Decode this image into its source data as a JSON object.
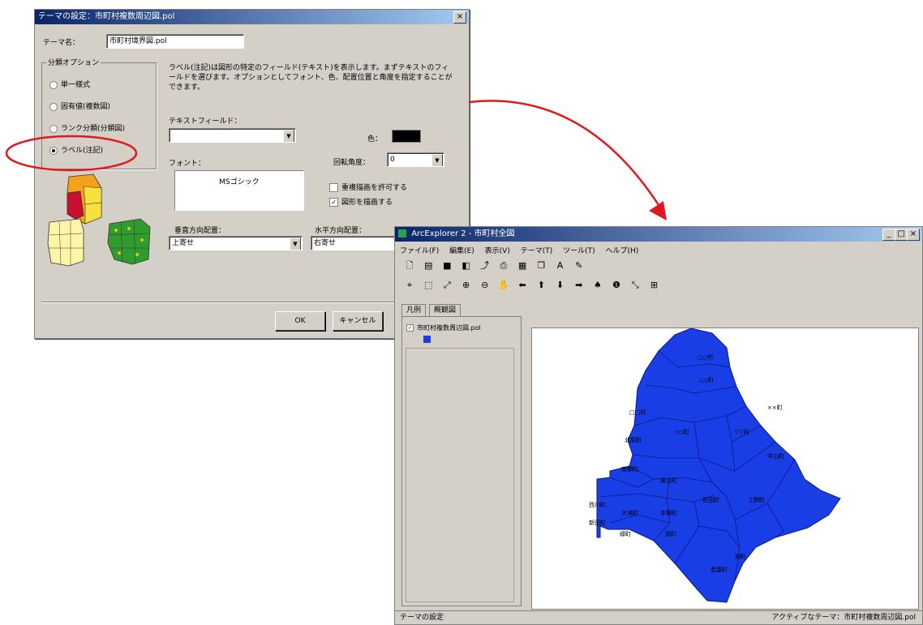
{
  "dialog": {
    "title": "テーマの設定：市町村複数周辺図.pol",
    "theme_name_label": "テーマ名：",
    "theme_name_value": "市町村境界図.pol",
    "classification_group": "分類オプション",
    "options": [
      "単一様式",
      "固有値(複数図)",
      "ランク分類(分類図)",
      "ラベル(注記)"
    ],
    "selected_option": 3,
    "description": "ラベル(注記)は図形の特定のフィールド(テキスト)を表示します。まずテキストのフィールドを選びます。オプションとしてフォント、色、配置位置と角度を指定することができます。",
    "text_field_label": "テキストフィールド：",
    "text_field_value": "",
    "color_label": "色：",
    "color_value": "#000000",
    "font_label": "フォント：",
    "font_value": "MSゴシック",
    "rotation_label": "回転角度：",
    "rotation_value": "0",
    "allow_overlap_label": "重複描画を許可する",
    "allow_overlap": false,
    "draw_shape_label": "図形を描画する",
    "draw_shape": true,
    "vertical_align_label": "垂直方向配置：",
    "vertical_align_value": "上寄せ",
    "horizontal_align_label": "水平方向配置：",
    "horizontal_align_value": "右寄せ",
    "ok_label": "OK",
    "cancel_label": "キャンセル"
  },
  "app": {
    "title": "ArcExplorer 2 - 市町村全図",
    "menu": [
      "ファイル(F)",
      "編集(E)",
      "表示(V)",
      "テーマ(T)",
      "ツール(T)",
      "ヘルプ(H)"
    ],
    "tabs": [
      "凡例",
      "概観図"
    ],
    "legend_layer": "市町村複数周辺図.pol",
    "legend_swatch_color": "#1a3ee6",
    "map_fill_color": "#1a3ee6",
    "map_labels": [
      "○○村",
      "△△町",
      "××町",
      "□□村",
      "◇◇町",
      "▽▽村",
      "北原町",
      "中山町",
      "南郷町",
      "東山町",
      "西川町",
      "大津町",
      "本郷町",
      "花田町",
      "上野町",
      "新田町",
      "緑町",
      "栄町",
      "旭町",
      "若葉町"
    ],
    "status_left": "テーマの設定",
    "status_right": "アクティブなテーマ：市町村複数周辺図.pol"
  },
  "colors": {
    "window_bg": "#d4d0c8",
    "titlebar_active": "#0a246a",
    "annotation": "#e0191f"
  }
}
